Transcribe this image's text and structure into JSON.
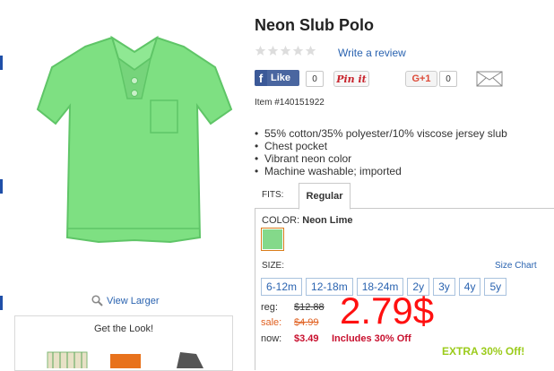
{
  "product": {
    "title": "Neon Slub Polo",
    "write_review": "Write a review",
    "rating_stars": 0,
    "item_number": "Item #140151922",
    "features": [
      "55% cotton/35% polyester/10% viscose jersey slub",
      "Chest pocket",
      "Vibrant neon color",
      "Machine washable; imported"
    ]
  },
  "social": {
    "fb_label": "Like",
    "fb_count": "0",
    "pinit_label": "Pin it",
    "gplus_label": "G+1",
    "gplus_count": "0"
  },
  "gallery": {
    "view_larger": "View Larger",
    "get_the_look": "Get the Look!"
  },
  "fits": {
    "label": "FITS:",
    "selected": "Regular"
  },
  "color": {
    "label": "COLOR:",
    "value": "Neon Lime",
    "swatch_hex": "#84d98a"
  },
  "size": {
    "label": "SIZE:",
    "chart_link": "Size Chart",
    "options": [
      "6-12m",
      "12-18m",
      "18-24m",
      "2y",
      "3y",
      "4y",
      "5y"
    ]
  },
  "pricing": {
    "reg_label": "reg:",
    "reg_value": "$12.88",
    "sale_label": "sale:",
    "sale_value": "$4.99",
    "now_label": "now:",
    "now_value": "$3.49",
    "includes": "Includes 30% Off",
    "overlay_price": "2.79$",
    "extra_promo": "EXTRA 30% Off!"
  },
  "colors": {
    "link": "#2a63b0",
    "price_red": "#c8102e",
    "overlay_red": "#ff1010",
    "promo_green": "#9bcb1b",
    "shirt_green": "#7ee082"
  }
}
